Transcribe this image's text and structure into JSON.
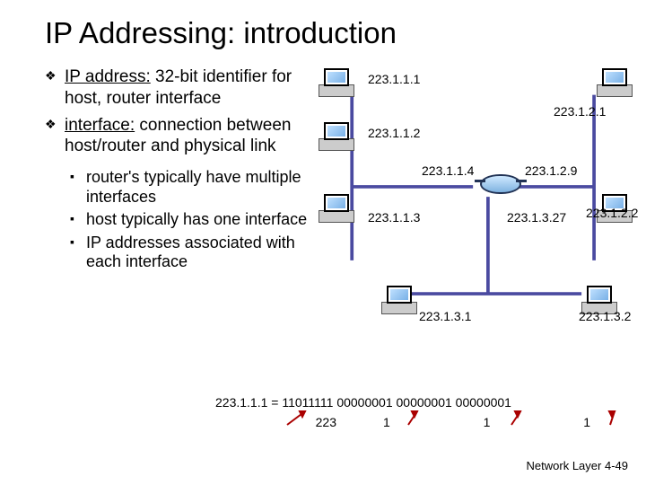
{
  "title": "IP Addressing: introduction",
  "bullets": {
    "b1_term": "IP address:",
    "b1_rest": " 32-bit identifier for host, router interface",
    "b2_term": "interface:",
    "b2_rest": " connection between host/router and physical link"
  },
  "subbullets": {
    "s1": "router's typically have multiple interfaces",
    "s2": "host typically has one interface",
    "s3": "IP addresses associated with each interface"
  },
  "ips": {
    "h_l1": "223.1.1.1",
    "h_l2": "223.1.1.2",
    "h_l3": "223.1.1.3",
    "h_r1": "223.1.2.1",
    "h_r2": "223.1.2.2",
    "r_left": "223.1.1.4",
    "r_right": "223.1.2.9",
    "r_down": "223.1.3.27",
    "b_l": "223.1.3.1",
    "b_r": "223.1.3.2"
  },
  "binary_line": "223.1.1.1 = 11011111 00000001 00000001 00000001",
  "dec": {
    "a": "223",
    "b": "1",
    "c": "1",
    "d": "1"
  },
  "footer": {
    "section": "Network Layer",
    "page": "4-49"
  }
}
